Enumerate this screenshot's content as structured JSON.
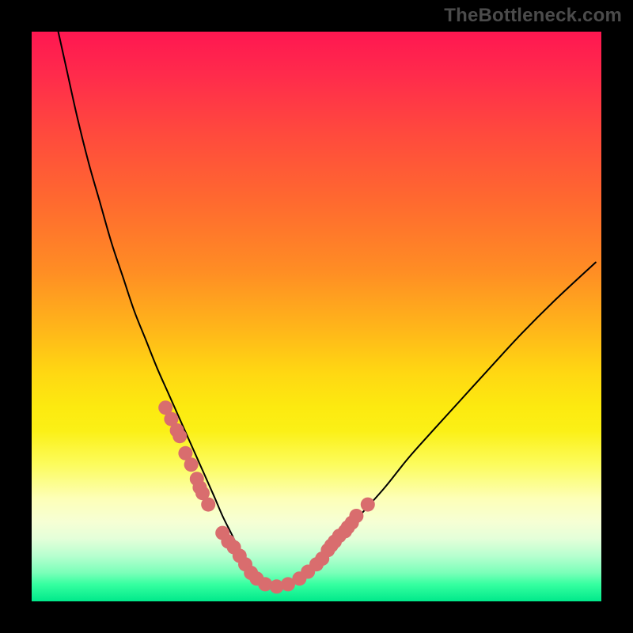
{
  "watermark": "TheBottleneck.com",
  "chart_data": {
    "type": "line",
    "title": "",
    "xlabel": "",
    "ylabel": "",
    "xlim": [
      0,
      100
    ],
    "ylim": [
      0,
      100
    ],
    "annotations": [],
    "series": [
      {
        "name": "bottleneck-curve",
        "x": [
          4,
          6,
          8,
          10,
          12,
          14,
          16,
          18,
          20,
          22,
          24,
          26,
          28,
          30,
          32,
          33.5,
          35,
          36.5,
          38,
          39.5,
          41,
          43,
          45,
          47,
          49,
          52,
          55,
          58,
          62,
          66,
          70,
          75,
          80,
          86,
          92,
          99
        ],
        "values": [
          103,
          94,
          85,
          77,
          70,
          63,
          57,
          51,
          46,
          41,
          36.5,
          32,
          27.5,
          23,
          18.5,
          15,
          12,
          9,
          6.5,
          4.5,
          3,
          2.5,
          2.8,
          4,
          6,
          9,
          12,
          15.5,
          20,
          25,
          29.5,
          35,
          40.5,
          47,
          53,
          59.5
        ]
      }
    ],
    "markers": {
      "name": "highlighted-points",
      "x": [
        23.5,
        24.5,
        25.5,
        26,
        27,
        28,
        29,
        29.5,
        30,
        31,
        33.5,
        34.5,
        35.5,
        36.5,
        37.5,
        38.5,
        39.5,
        41,
        43,
        45,
        47,
        48.5,
        50,
        51,
        52,
        52.6,
        53.2,
        54,
        55,
        55.5,
        56.2,
        57,
        59
      ],
      "values": [
        34,
        32,
        30,
        29,
        26,
        24,
        21.5,
        20,
        19,
        17,
        12,
        10.5,
        9.5,
        8,
        6.5,
        5,
        4,
        3,
        2.6,
        3,
        4,
        5.2,
        6.5,
        7.5,
        9,
        9.8,
        10.5,
        11.5,
        12.3,
        13,
        13.8,
        15,
        17
      ]
    },
    "gradient_bands": [
      {
        "name": "red",
        "from": 100,
        "to": 56
      },
      {
        "name": "orange",
        "from": 56,
        "to": 40
      },
      {
        "name": "yellow",
        "from": 40,
        "to": 24
      },
      {
        "name": "pale-yellow",
        "from": 24,
        "to": 14
      },
      {
        "name": "mint-green",
        "from": 14,
        "to": 0
      }
    ]
  }
}
